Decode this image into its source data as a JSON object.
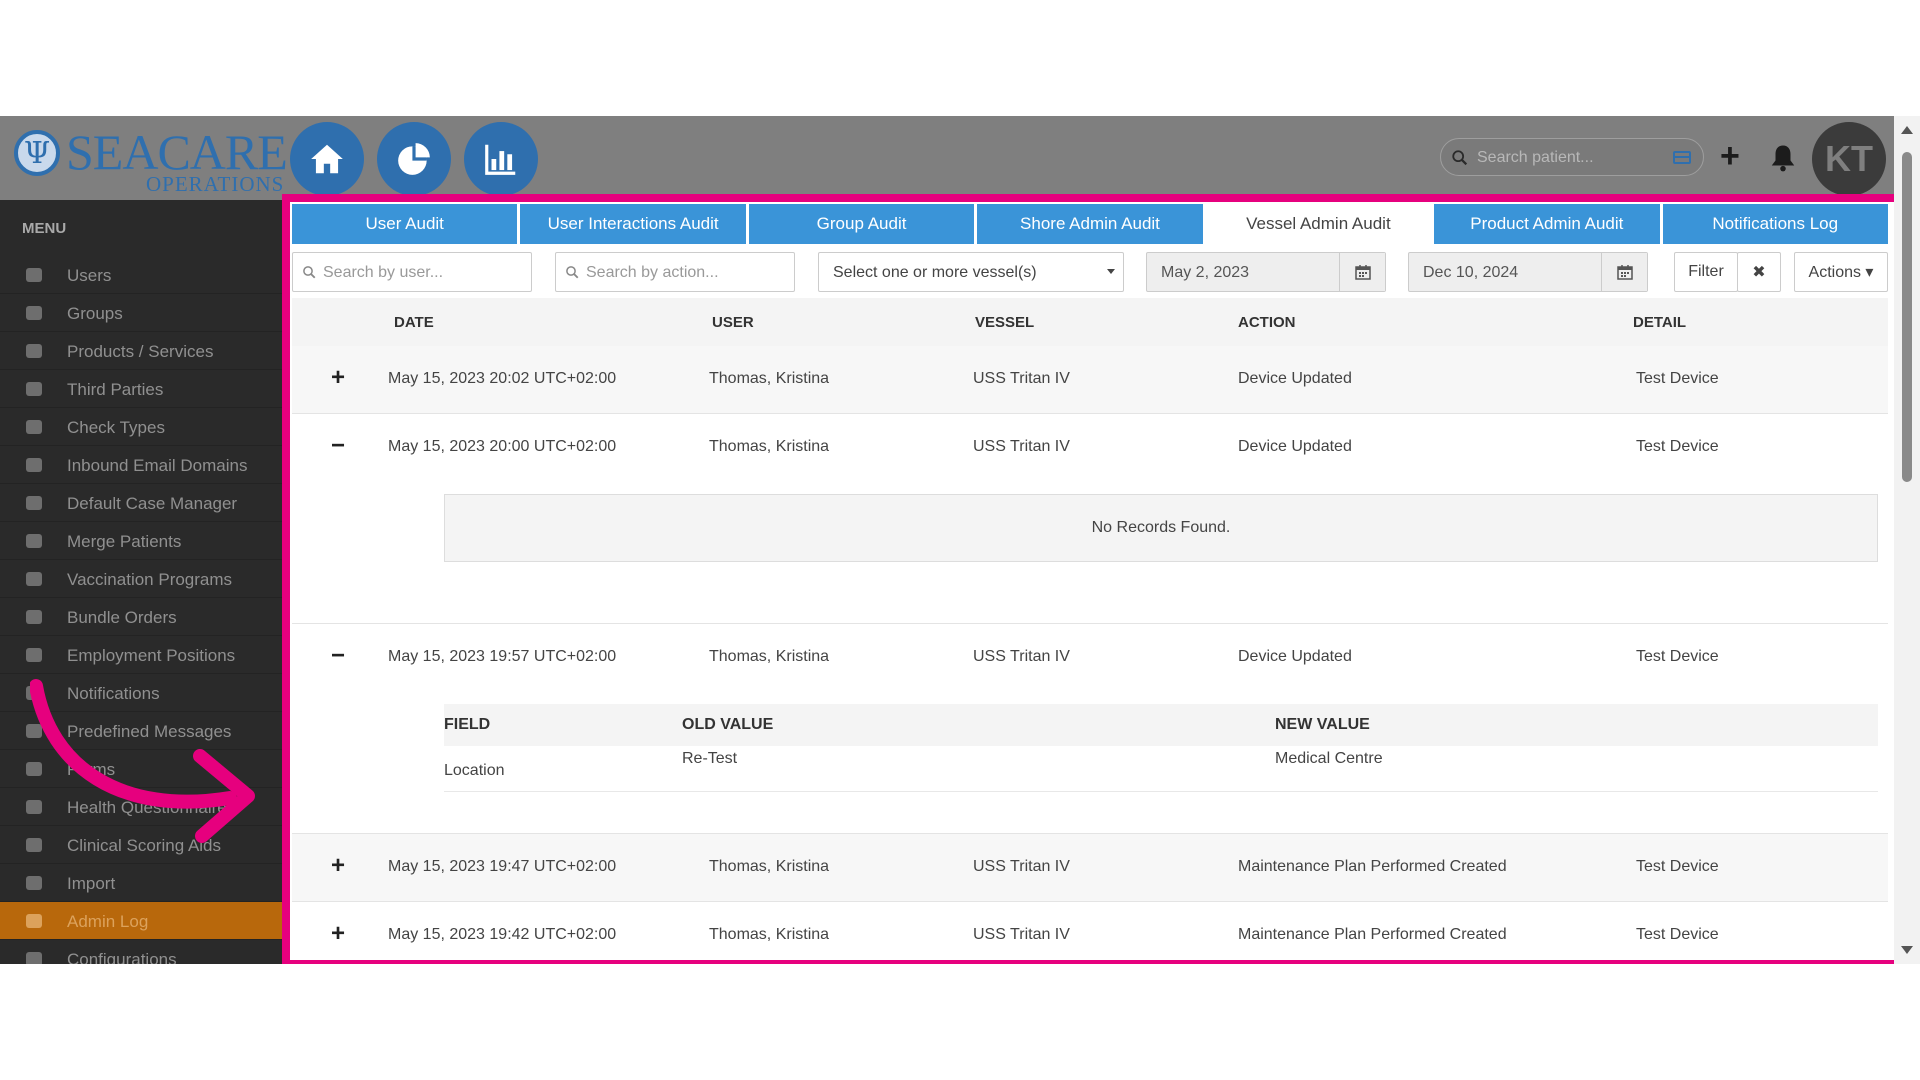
{
  "brand": {
    "name": "SEACARE",
    "sub": "OPERATIONS",
    "color": "#2f6fae"
  },
  "header": {
    "nav_icons": [
      "home-icon",
      "pie-chart-icon",
      "bar-chart-icon"
    ],
    "search_placeholder": "Search patient...",
    "add_symbol": "+",
    "avatar_initials": "KT"
  },
  "sidebar": {
    "title": "MENU",
    "items": [
      {
        "label": "Users",
        "icon": "user-icon"
      },
      {
        "label": "Groups",
        "icon": "group-icon"
      },
      {
        "label": "Products / Services",
        "icon": "list-icon"
      },
      {
        "label": "Third Parties",
        "icon": "building-icon"
      },
      {
        "label": "Check Types",
        "icon": "money-icon"
      },
      {
        "label": "Inbound Email Domains",
        "icon": "at-icon"
      },
      {
        "label": "Default Case Manager",
        "icon": "id-card-icon"
      },
      {
        "label": "Merge Patients",
        "icon": "compress-icon"
      },
      {
        "label": "Vaccination Programs",
        "icon": "syringe-icon"
      },
      {
        "label": "Bundle Orders",
        "icon": "stethoscope-icon"
      },
      {
        "label": "Employment Positions",
        "icon": "wrench-icon"
      },
      {
        "label": "Notifications",
        "icon": "bullhorn-icon"
      },
      {
        "label": "Predefined Messages",
        "icon": "envelope-icon"
      },
      {
        "label": "Forms",
        "icon": "file-icon"
      },
      {
        "label": "Health Questionnaires",
        "icon": "list-alt-icon"
      },
      {
        "label": "Clinical Scoring Aids",
        "icon": "info-icon"
      },
      {
        "label": "Import",
        "icon": "upload-icon"
      },
      {
        "label": "Admin Log",
        "icon": "sort-icon",
        "active": true
      },
      {
        "label": "Configurations",
        "icon": "cogs-icon"
      }
    ]
  },
  "tabs": [
    {
      "label": "User Audit"
    },
    {
      "label": "User Interactions Audit"
    },
    {
      "label": "Group Audit"
    },
    {
      "label": "Shore Admin Audit"
    },
    {
      "label": "Vessel Admin Audit",
      "active": true
    },
    {
      "label": "Product Admin Audit"
    },
    {
      "label": "Notifications Log"
    }
  ],
  "filters": {
    "user_placeholder": "Search by user...",
    "action_placeholder": "Search by action...",
    "vessel_select": "Select one or more vessel(s)",
    "date_from": "May 2, 2023",
    "date_to": "Dec 10, 2024",
    "filter_label": "Filter",
    "clear_symbol": "✖",
    "actions_label": "Actions ▾"
  },
  "table": {
    "columns": [
      "DATE",
      "USER",
      "VESSEL",
      "ACTION",
      "DETAIL"
    ],
    "rows": [
      {
        "toggle": "+",
        "date": "May 15, 2023 20:02 UTC+02:00",
        "user": "Thomas, Kristina",
        "vessel": "USS Tritan IV",
        "action": "Device Updated",
        "detail": "Test Device"
      },
      {
        "toggle": "−",
        "date": "May 15, 2023 20:00 UTC+02:00",
        "user": "Thomas, Kristina",
        "vessel": "USS Tritan IV",
        "action": "Device Updated",
        "detail": "Test Device"
      },
      {
        "toggle": "−",
        "date": "May 15, 2023 19:57 UTC+02:00",
        "user": "Thomas, Kristina",
        "vessel": "USS Tritan IV",
        "action": "Device Updated",
        "detail": "Test Device"
      },
      {
        "toggle": "+",
        "date": "May 15, 2023 19:47 UTC+02:00",
        "user": "Thomas, Kristina",
        "vessel": "USS Tritan IV",
        "action": "Maintenance Plan Performed Created",
        "detail": "Test Device"
      },
      {
        "toggle": "+",
        "date": "May 15, 2023 19:42 UTC+02:00",
        "user": "Thomas, Kristina",
        "vessel": "USS Tritan IV",
        "action": "Maintenance Plan Performed Created",
        "detail": "Test Device"
      }
    ],
    "no_records": "No Records Found.",
    "changes": {
      "columns": [
        "FIELD",
        "OLD VALUE",
        "NEW VALUE"
      ],
      "row": {
        "field": "Location",
        "old": "Re-Test",
        "new": "Medical Centre"
      }
    }
  },
  "colors": {
    "tab_blue": "#3a94d8",
    "highlight": "#e6007e",
    "active_menu": "#b8680c",
    "sidebar": "#2a2a2a"
  }
}
